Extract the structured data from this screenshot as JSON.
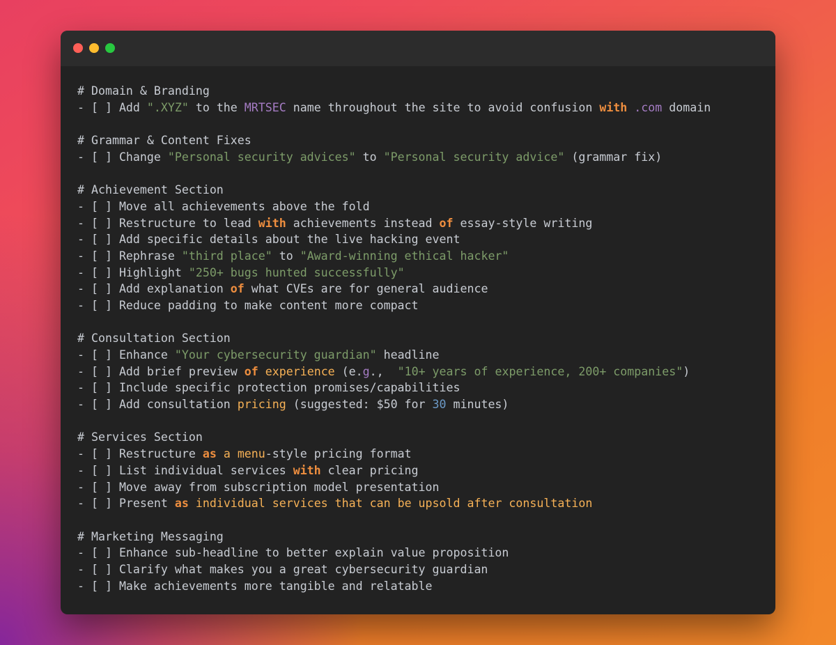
{
  "window": {
    "controls": [
      "close",
      "minimize",
      "zoom"
    ],
    "colors": {
      "close": "#fe5f57",
      "minimize": "#febc2e",
      "zoom": "#28c840"
    }
  },
  "lines": {
    "h1": "# Domain & Branding",
    "l1": [
      "- [ ] Add ",
      "\".XYZ\"",
      " to the ",
      "MRTSEC",
      " name throughout the site to avoid confusion ",
      "with",
      " ",
      ".com",
      " domain"
    ],
    "h2": "# Grammar & Content Fixes",
    "l2": [
      "- [ ] Change ",
      "\"Personal security advices\"",
      " to ",
      "\"Personal security advice\"",
      " (grammar fix)"
    ],
    "h3": "# Achievement Section",
    "l3a": "- [ ] Move all achievements above the fold",
    "l3b": [
      "- [ ] Restructure to lead ",
      "with",
      " achievements instead ",
      "of",
      " essay-style writing"
    ],
    "l3c": "- [ ] Add specific details about the live hacking event",
    "l3d": [
      "- [ ] Rephrase ",
      "\"third place\"",
      " to ",
      "\"Award-winning ethical hacker\""
    ],
    "l3e": [
      "- [ ] Highlight ",
      "\"250+ bugs hunted successfully\""
    ],
    "l3f": [
      "- [ ] Add explanation ",
      "of",
      " what CVEs are for general audience"
    ],
    "l3g": "- [ ] Reduce padding to make content more compact",
    "h4": "# Consultation Section",
    "l4a": [
      "- [ ] Enhance ",
      "\"Your cybersecurity guardian\"",
      " headline"
    ],
    "l4b": [
      "- [ ] Add brief preview ",
      "of",
      " ",
      "experience",
      " (e.",
      "g",
      ".,  ",
      "\"10+ years of experience, 200+ companies\"",
      ")"
    ],
    "l4c": "- [ ] Include specific protection promises/capabilities",
    "l4d": [
      "- [ ] Add consultation ",
      "pricing",
      " (suggested: $50 for ",
      "30",
      " minutes)"
    ],
    "h5": "# Services Section",
    "l5a": [
      "- [ ] Restructure ",
      "as",
      " ",
      "a",
      " ",
      "menu",
      "-style pricing format"
    ],
    "l5b": [
      "- [ ] List individual services ",
      "with",
      " clear pricing"
    ],
    "l5c": "- [ ] Move away from subscription model presentation",
    "l5d": [
      "- [ ] Present ",
      "as",
      " ",
      "individual services that can be upsold after consultation"
    ],
    "h6": "# Marketing Messaging",
    "l6a": "- [ ] Enhance sub-headline to better explain value proposition",
    "l6b": "- [ ] Clarify what makes you a great cybersecurity guardian",
    "l6c": "- [ ] Make achievements more tangible and relatable"
  },
  "syntax_colors": {
    "text": "#c8ccd3",
    "string": "#7d9c69",
    "keyword": "#ee8e3f",
    "keyword_light": "#f6b156",
    "identifier": "#a57cc4",
    "number": "#6c9ac7",
    "background": "#222222",
    "titlebar": "#2c2c2c"
  }
}
